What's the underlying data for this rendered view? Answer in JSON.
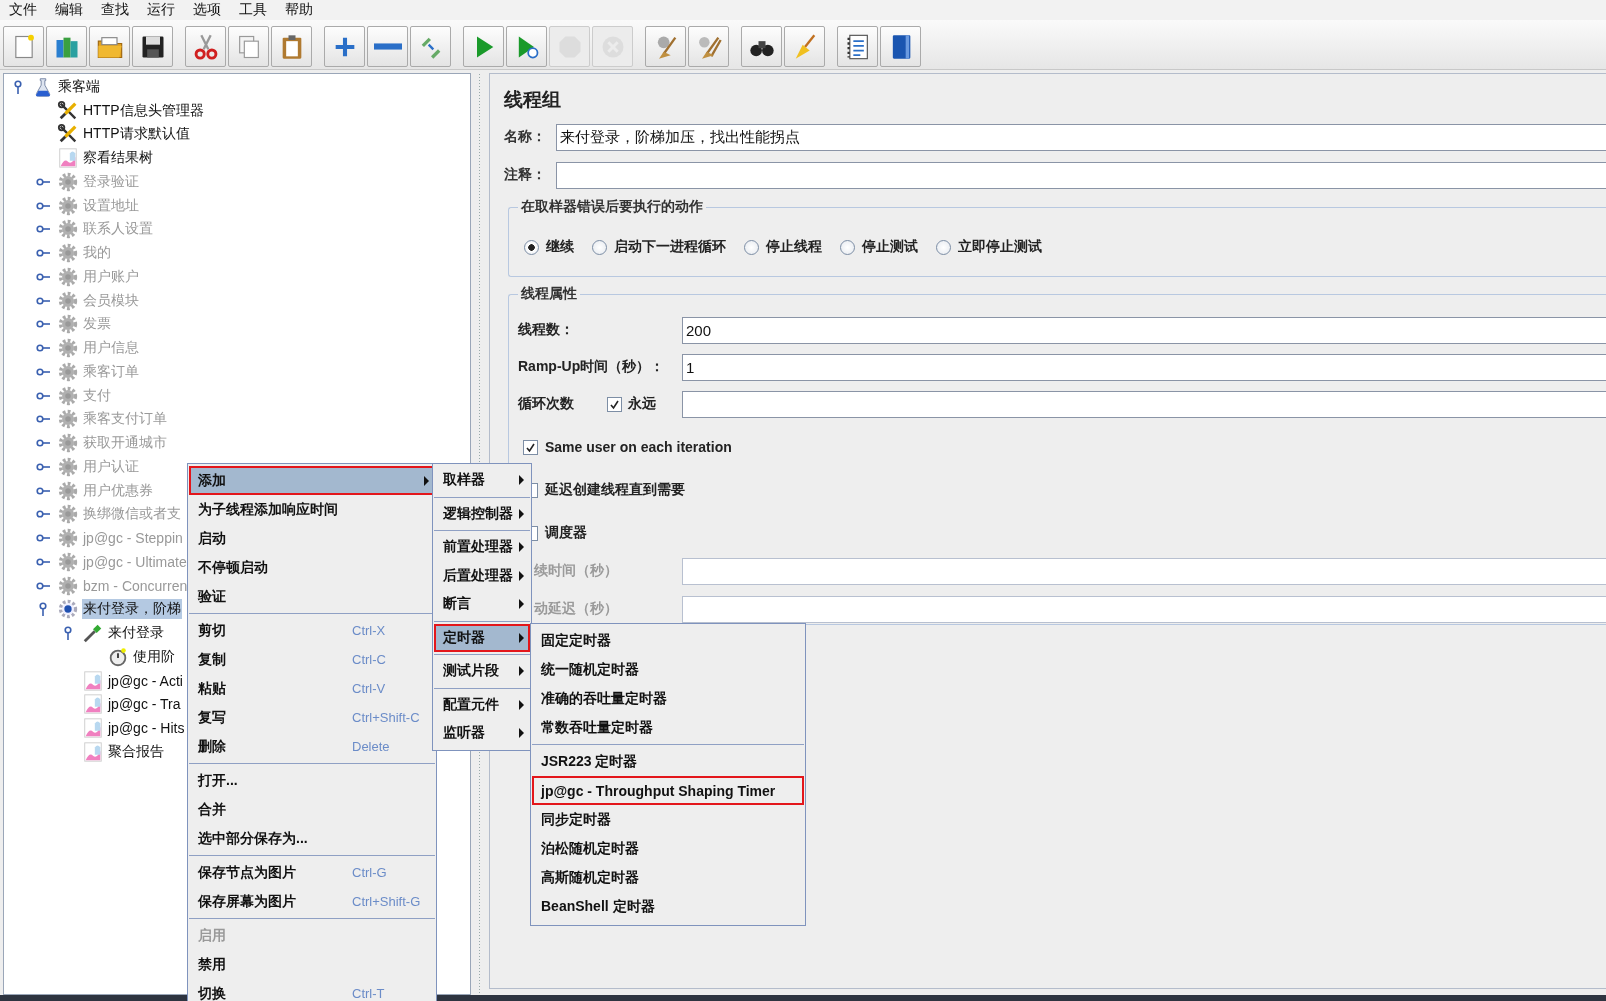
{
  "menubar": [
    "文件",
    "编辑",
    "查找",
    "运行",
    "选项",
    "工具",
    "帮助"
  ],
  "toolbar": [
    [
      {
        "disabled": false
      },
      {
        "disabled": false
      },
      {
        "disabled": false
      },
      {
        "disabled": false
      }
    ],
    [
      {
        "disabled": false
      },
      {
        "disabled": false
      },
      {
        "disabled": false
      }
    ],
    [
      {
        "disabled": false
      },
      {
        "disabled": false
      },
      {
        "disabled": false
      }
    ],
    [
      {
        "disabled": false
      },
      {
        "disabled": false
      },
      {
        "disabled": true
      },
      {
        "disabled": true
      }
    ],
    [
      {
        "disabled": false
      },
      {
        "disabled": false
      }
    ],
    [
      {
        "disabled": false
      },
      {
        "disabled": false
      }
    ],
    [
      {
        "disabled": false
      },
      {
        "disabled": false
      }
    ]
  ],
  "tree": {
    "label": "乘客端",
    "kind": "test-plan",
    "expanded": true,
    "selected": false,
    "disabled": false,
    "children": [
      {
        "label": "HTTP信息头管理器",
        "kind": "config",
        "selected": false,
        "disabled": false
      },
      {
        "label": "HTTP请求默认值",
        "kind": "config",
        "selected": false,
        "disabled": false
      },
      {
        "label": "察看结果树",
        "kind": "listener",
        "selected": false,
        "disabled": false
      },
      {
        "label": "登录验证",
        "kind": "thread-group",
        "expanded": false,
        "selected": false,
        "disabled": true
      },
      {
        "label": "设置地址",
        "kind": "thread-group",
        "expanded": false,
        "selected": false,
        "disabled": true
      },
      {
        "label": "联系人设置",
        "kind": "thread-group",
        "expanded": false,
        "selected": false,
        "disabled": true
      },
      {
        "label": "我的",
        "kind": "thread-group",
        "expanded": false,
        "selected": false,
        "disabled": true
      },
      {
        "label": "用户账户",
        "kind": "thread-group",
        "expanded": false,
        "selected": false,
        "disabled": true
      },
      {
        "label": "会员模块",
        "kind": "thread-group",
        "expanded": false,
        "selected": false,
        "disabled": true
      },
      {
        "label": "发票",
        "kind": "thread-group",
        "expanded": false,
        "selected": false,
        "disabled": true
      },
      {
        "label": "用户信息",
        "kind": "thread-group",
        "expanded": false,
        "selected": false,
        "disabled": true
      },
      {
        "label": "乘客订单",
        "kind": "thread-group",
        "expanded": false,
        "selected": false,
        "disabled": true
      },
      {
        "label": "支付",
        "kind": "thread-group",
        "expanded": false,
        "selected": false,
        "disabled": true
      },
      {
        "label": "乘客支付订单",
        "kind": "thread-group",
        "expanded": false,
        "selected": false,
        "disabled": true
      },
      {
        "label": "获取开通城市",
        "kind": "thread-group",
        "expanded": false,
        "selected": false,
        "disabled": true
      },
      {
        "label": "用户认证",
        "kind": "thread-group",
        "expanded": false,
        "selected": false,
        "disabled": true
      },
      {
        "label": "用户优惠券",
        "kind": "thread-group",
        "expanded": false,
        "selected": false,
        "disabled": true
      },
      {
        "label": "换绑微信或者支",
        "kind": "thread-group",
        "expanded": false,
        "selected": false,
        "disabled": true
      },
      {
        "label": "jp@gc - Steppin",
        "kind": "thread-group",
        "expanded": false,
        "selected": false,
        "disabled": true
      },
      {
        "label": "jp@gc - Ultimate",
        "kind": "thread-group",
        "expanded": false,
        "selected": false,
        "disabled": true
      },
      {
        "label": "bzm - Concurren",
        "kind": "thread-group",
        "expanded": false,
        "selected": false,
        "disabled": true
      },
      {
        "label": "来付登录，阶梯",
        "kind": "thread-group",
        "expanded": true,
        "selected": true,
        "disabled": false,
        "children": [
          {
            "label": "来付登录",
            "kind": "sampler",
            "expanded": true,
            "selected": false,
            "disabled": false,
            "children": [
              {
                "label": "使用阶",
                "kind": "timer",
                "selected": false,
                "disabled": false
              }
            ]
          },
          {
            "label": "jp@gc - Acti",
            "kind": "listener",
            "selected": false,
            "disabled": false
          },
          {
            "label": "jp@gc - Tra",
            "kind": "listener",
            "selected": false,
            "disabled": false
          },
          {
            "label": "jp@gc - Hits",
            "kind": "listener",
            "selected": false,
            "disabled": false
          },
          {
            "label": "聚合报告",
            "kind": "listener",
            "selected": false,
            "disabled": false
          }
        ]
      }
    ]
  },
  "panel": {
    "title": "线程组",
    "name": {
      "label": "名称：",
      "value": "来付登录，阶梯加压，找出性能拐点"
    },
    "comment": {
      "label": "注释："
    },
    "error_action": {
      "title": "在取样器错误后要执行的动作",
      "options": [
        {
          "label": "继续",
          "selected": true
        },
        {
          "label": "启动下一进程循环",
          "selected": false
        },
        {
          "label": "停止线程",
          "selected": false
        },
        {
          "label": "停止测试",
          "selected": false
        },
        {
          "label": "立即停止测试",
          "selected": false
        }
      ]
    },
    "thread_properties": {
      "title": "线程属性",
      "threads": {
        "label": "线程数：",
        "value": "200"
      },
      "ramp_up": {
        "label": "Ramp-Up时间（秒）：",
        "value": "1"
      },
      "loop": {
        "label": "循环次数",
        "forever": {
          "label": "永远",
          "checked": true
        }
      },
      "checks": [
        {
          "label": "Same user on each iteration",
          "checked": true
        },
        {
          "label": "延迟创建线程直到需要",
          "checked": false,
          "partly_hidden": true
        },
        {
          "label": "调度器",
          "checked": false,
          "partly_hidden": true
        }
      ],
      "scheduler_fields": [
        {
          "label": "续时间（秒）",
          "disabled": true
        },
        {
          "label": "动延迟（秒）",
          "disabled": true
        }
      ]
    }
  },
  "context_menu": {
    "groups": [
      [
        {
          "label": "添加",
          "selected": true,
          "disabled": false,
          "submenu": true,
          "annotated": true
        },
        {
          "label": "为子线程添加响应时间",
          "selected": false,
          "disabled": false,
          "submenu": false,
          "annotated": false
        },
        {
          "label": "启动",
          "selected": false,
          "disabled": false,
          "submenu": false,
          "annotated": false
        },
        {
          "label": "不停顿启动",
          "selected": false,
          "disabled": false,
          "submenu": false,
          "annotated": false
        },
        {
          "label": "验证",
          "selected": false,
          "disabled": false,
          "submenu": false,
          "annotated": false
        }
      ],
      [
        {
          "label": "剪切",
          "shortcut": "Ctrl-X",
          "selected": false,
          "disabled": false,
          "submenu": false,
          "annotated": false
        },
        {
          "label": "复制",
          "shortcut": "Ctrl-C",
          "selected": false,
          "disabled": false,
          "submenu": false,
          "annotated": false
        },
        {
          "label": "粘贴",
          "shortcut": "Ctrl-V",
          "selected": false,
          "disabled": false,
          "submenu": false,
          "annotated": false
        },
        {
          "label": "复写",
          "shortcut": "Ctrl+Shift-C",
          "selected": false,
          "disabled": false,
          "submenu": false,
          "annotated": false
        },
        {
          "label": "删除",
          "shortcut": "Delete",
          "selected": false,
          "disabled": false,
          "submenu": false,
          "annotated": false
        }
      ],
      [
        {
          "label": "打开...",
          "selected": false,
          "disabled": false,
          "submenu": false,
          "annotated": false
        },
        {
          "label": "合并",
          "selected": false,
          "disabled": false,
          "submenu": false,
          "annotated": false
        },
        {
          "label": "选中部分保存为...",
          "selected": false,
          "disabled": false,
          "submenu": false,
          "annotated": false
        }
      ],
      [
        {
          "label": "保存节点为图片",
          "shortcut": "Ctrl-G",
          "selected": false,
          "disabled": false,
          "submenu": false,
          "annotated": false
        },
        {
          "label": "保存屏幕为图片",
          "shortcut": "Ctrl+Shift-G",
          "selected": false,
          "disabled": false,
          "submenu": false,
          "annotated": false
        }
      ],
      [
        {
          "label": "启用",
          "selected": false,
          "disabled": true,
          "submenu": false,
          "annotated": false
        },
        {
          "label": "禁用",
          "selected": false,
          "disabled": false,
          "submenu": false,
          "annotated": false
        },
        {
          "label": "切换",
          "shortcut": "Ctrl-T",
          "selected": false,
          "disabled": false,
          "submenu": false,
          "annotated": false
        }
      ]
    ]
  },
  "add_submenu": {
    "groups": [
      [
        {
          "label": "取样器",
          "selected": false,
          "submenu": true,
          "annotated": false
        }
      ],
      [
        {
          "label": "逻辑控制器",
          "selected": false,
          "submenu": true,
          "annotated": false
        }
      ],
      [
        {
          "label": "前置处理器",
          "selected": false,
          "submenu": true,
          "annotated": false
        },
        {
          "label": "后置处理器",
          "selected": false,
          "submenu": true,
          "annotated": false
        },
        {
          "label": "断言",
          "selected": false,
          "submenu": true,
          "annotated": false
        }
      ],
      [
        {
          "label": "定时器",
          "selected": true,
          "submenu": true,
          "annotated": true
        }
      ],
      [
        {
          "label": "测试片段",
          "selected": false,
          "submenu": true,
          "annotated": false
        }
      ],
      [
        {
          "label": "配置元件",
          "selected": false,
          "submenu": true,
          "annotated": false
        },
        {
          "label": "监听器",
          "selected": false,
          "submenu": true,
          "annotated": false
        }
      ]
    ]
  },
  "timer_submenu": {
    "groups": [
      [
        {
          "label": "固定定时器",
          "selected": false,
          "annotated": false
        },
        {
          "label": "统一随机定时器",
          "selected": false,
          "annotated": false
        },
        {
          "label": "准确的吞吐量定时器",
          "selected": false,
          "annotated": false
        },
        {
          "label": "常数吞吐量定时器",
          "selected": false,
          "annotated": false
        }
      ],
      [
        {
          "label": "JSR223 定时器",
          "selected": false,
          "annotated": false
        },
        {
          "label": "jp@gc - Throughput Shaping Timer",
          "selected": false,
          "annotated": true
        },
        {
          "label": "同步定时器",
          "selected": false,
          "annotated": false
        },
        {
          "label": "泊松随机定时器",
          "selected": false,
          "annotated": false
        },
        {
          "label": "高斯随机定时器",
          "selected": false,
          "annotated": false
        },
        {
          "label": "BeanShell 定时器",
          "selected": false,
          "annotated": false
        }
      ]
    ]
  }
}
